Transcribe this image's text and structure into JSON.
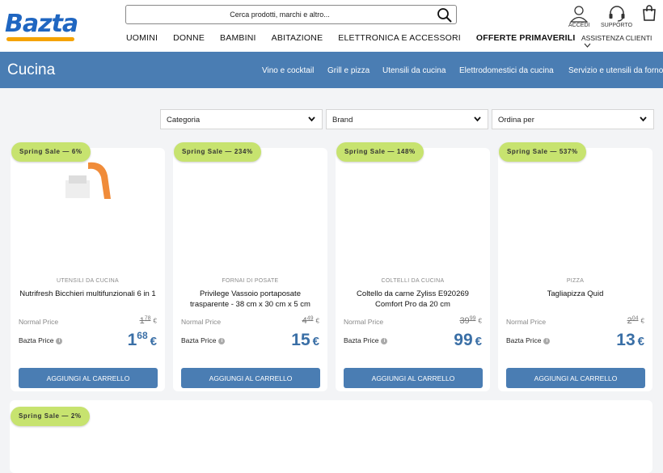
{
  "header": {
    "logo": "Bazta",
    "search": {
      "placeholder": "Cerca prodotti, marchi e altro..."
    },
    "nav": [
      "UOMINI",
      "DONNE",
      "BAMBINI",
      "ABITAZIONE",
      "ELETTRONICA E ACCESSORI",
      "OFFERTE PRIMAVERILI"
    ],
    "icons": {
      "login": "ACCEDI",
      "support": "SUPPORTO"
    },
    "assist": "ASSISTENZA CLIENTI"
  },
  "category": {
    "title": "Cucina",
    "links": [
      "Vino e cocktail",
      "Grill e pizza",
      "Utensili da cucina",
      "Elettrodomestici da cucina",
      "Servizio e utensili da forno"
    ]
  },
  "filters": [
    "Categoria",
    "Brand",
    "Ordina per"
  ],
  "labels": {
    "normal": "Normal Price",
    "bazta": "Bazta Price",
    "add": "AGGIUNGI AL CARRELLO"
  },
  "products": [
    {
      "badge": "Spring Sale — 6%",
      "category": "UTENSILI DA CUCINA",
      "name": "Nutrifresh Bicchieri multifunzionali 6 in 1",
      "old_int": "1",
      "old_dec": "78",
      "new_int": "1",
      "new_dec": "68"
    },
    {
      "badge": "Spring Sale — 234%",
      "category": "FORNAI DI POSATE",
      "name": "Privilege Vassoio portaposate trasparente - 38 cm x 30 cm x 5 cm",
      "old_int": "4",
      "old_dec": "49",
      "new_int": "15",
      "new_dec": ""
    },
    {
      "badge": "Spring Sale — 148%",
      "category": "COLTELLI DA CUCINA",
      "name": "Coltello da carne Zyliss E920269 Comfort Pro da 20 cm",
      "old_int": "39",
      "old_dec": "99",
      "new_int": "99",
      "new_dec": ""
    },
    {
      "badge": "Spring Sale — 537%",
      "category": "PIZZA",
      "name": "Tagliapizza Quid",
      "old_int": "2",
      "old_dec": "04",
      "new_int": "13",
      "new_dec": ""
    }
  ],
  "extra_badge": "Spring Sale — 2%",
  "currency": "€",
  "colors": {
    "brand_blue": "#4a7db3",
    "logo_blue": "#1f66c1",
    "badge_green": "#c7e36f"
  }
}
